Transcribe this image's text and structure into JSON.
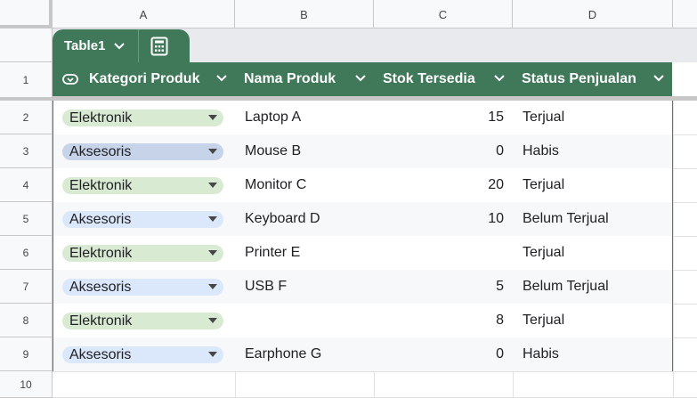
{
  "columns": [
    "A",
    "B",
    "C",
    "D"
  ],
  "rows": [
    "1",
    "2",
    "3",
    "4",
    "5",
    "6",
    "7",
    "8",
    "9",
    "10"
  ],
  "table": {
    "name": "Table1",
    "headers": [
      "Kategori Produk",
      "Nama Produk",
      "Stok Tersedia",
      "Status Penjualan"
    ],
    "rows": [
      {
        "kategori": "Elektronik",
        "nama": "Laptop A",
        "stok": "15",
        "status": "Terjual"
      },
      {
        "kategori": "Aksesoris",
        "nama": "Mouse B",
        "stok": "0",
        "status": "Habis"
      },
      {
        "kategori": "Elektronik",
        "nama": "Monitor C",
        "stok": "20",
        "status": "Terjual"
      },
      {
        "kategori": "Aksesoris",
        "nama": "Keyboard D",
        "stok": "10",
        "status": "Belum Terjual"
      },
      {
        "kategori": "Elektronik",
        "nama": "Printer E",
        "stok": "",
        "status": "Terjual"
      },
      {
        "kategori": "Aksesoris",
        "nama": "USB F",
        "stok": "5",
        "status": "Belum Terjual"
      },
      {
        "kategori": "Elektronik",
        "nama": "",
        "stok": "8",
        "status": "Terjual"
      },
      {
        "kategori": "Aksesoris",
        "nama": "Earphone G",
        "stok": "0",
        "status": "Habis"
      }
    ]
  },
  "colors": {
    "table_green": "#40785a",
    "chip_elektronik": "#d9ead3",
    "chip_aksesoris": "#dbe8fb",
    "chip_aksesoris_selected": "#c6d3e8"
  }
}
